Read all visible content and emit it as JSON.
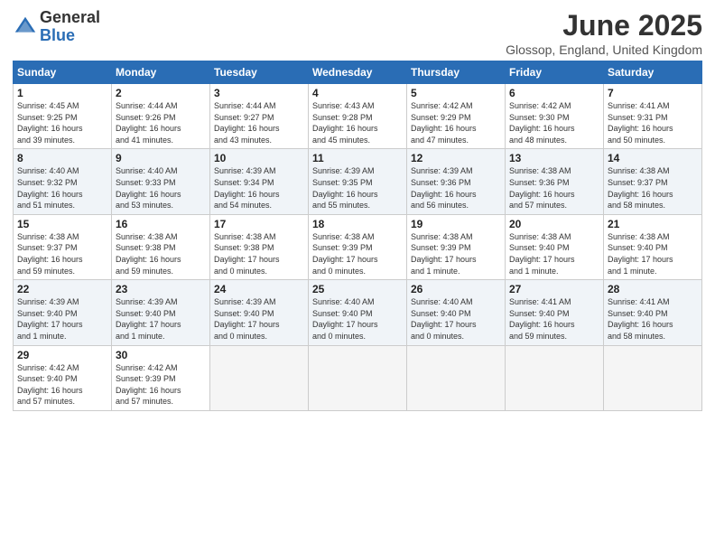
{
  "logo": {
    "general": "General",
    "blue": "Blue"
  },
  "title": "June 2025",
  "subtitle": "Glossop, England, United Kingdom",
  "days_of_week": [
    "Sunday",
    "Monday",
    "Tuesday",
    "Wednesday",
    "Thursday",
    "Friday",
    "Saturday"
  ],
  "weeks": [
    [
      {
        "day": "1",
        "info": "Sunrise: 4:45 AM\nSunset: 9:25 PM\nDaylight: 16 hours\nand 39 minutes."
      },
      {
        "day": "2",
        "info": "Sunrise: 4:44 AM\nSunset: 9:26 PM\nDaylight: 16 hours\nand 41 minutes."
      },
      {
        "day": "3",
        "info": "Sunrise: 4:44 AM\nSunset: 9:27 PM\nDaylight: 16 hours\nand 43 minutes."
      },
      {
        "day": "4",
        "info": "Sunrise: 4:43 AM\nSunset: 9:28 PM\nDaylight: 16 hours\nand 45 minutes."
      },
      {
        "day": "5",
        "info": "Sunrise: 4:42 AM\nSunset: 9:29 PM\nDaylight: 16 hours\nand 47 minutes."
      },
      {
        "day": "6",
        "info": "Sunrise: 4:42 AM\nSunset: 9:30 PM\nDaylight: 16 hours\nand 48 minutes."
      },
      {
        "day": "7",
        "info": "Sunrise: 4:41 AM\nSunset: 9:31 PM\nDaylight: 16 hours\nand 50 minutes."
      }
    ],
    [
      {
        "day": "8",
        "info": "Sunrise: 4:40 AM\nSunset: 9:32 PM\nDaylight: 16 hours\nand 51 minutes."
      },
      {
        "day": "9",
        "info": "Sunrise: 4:40 AM\nSunset: 9:33 PM\nDaylight: 16 hours\nand 53 minutes."
      },
      {
        "day": "10",
        "info": "Sunrise: 4:39 AM\nSunset: 9:34 PM\nDaylight: 16 hours\nand 54 minutes."
      },
      {
        "day": "11",
        "info": "Sunrise: 4:39 AM\nSunset: 9:35 PM\nDaylight: 16 hours\nand 55 minutes."
      },
      {
        "day": "12",
        "info": "Sunrise: 4:39 AM\nSunset: 9:36 PM\nDaylight: 16 hours\nand 56 minutes."
      },
      {
        "day": "13",
        "info": "Sunrise: 4:38 AM\nSunset: 9:36 PM\nDaylight: 16 hours\nand 57 minutes."
      },
      {
        "day": "14",
        "info": "Sunrise: 4:38 AM\nSunset: 9:37 PM\nDaylight: 16 hours\nand 58 minutes."
      }
    ],
    [
      {
        "day": "15",
        "info": "Sunrise: 4:38 AM\nSunset: 9:37 PM\nDaylight: 16 hours\nand 59 minutes."
      },
      {
        "day": "16",
        "info": "Sunrise: 4:38 AM\nSunset: 9:38 PM\nDaylight: 16 hours\nand 59 minutes."
      },
      {
        "day": "17",
        "info": "Sunrise: 4:38 AM\nSunset: 9:38 PM\nDaylight: 17 hours\nand 0 minutes."
      },
      {
        "day": "18",
        "info": "Sunrise: 4:38 AM\nSunset: 9:39 PM\nDaylight: 17 hours\nand 0 minutes."
      },
      {
        "day": "19",
        "info": "Sunrise: 4:38 AM\nSunset: 9:39 PM\nDaylight: 17 hours\nand 1 minute."
      },
      {
        "day": "20",
        "info": "Sunrise: 4:38 AM\nSunset: 9:40 PM\nDaylight: 17 hours\nand 1 minute."
      },
      {
        "day": "21",
        "info": "Sunrise: 4:38 AM\nSunset: 9:40 PM\nDaylight: 17 hours\nand 1 minute."
      }
    ],
    [
      {
        "day": "22",
        "info": "Sunrise: 4:39 AM\nSunset: 9:40 PM\nDaylight: 17 hours\nand 1 minute."
      },
      {
        "day": "23",
        "info": "Sunrise: 4:39 AM\nSunset: 9:40 PM\nDaylight: 17 hours\nand 1 minute."
      },
      {
        "day": "24",
        "info": "Sunrise: 4:39 AM\nSunset: 9:40 PM\nDaylight: 17 hours\nand 0 minutes."
      },
      {
        "day": "25",
        "info": "Sunrise: 4:40 AM\nSunset: 9:40 PM\nDaylight: 17 hours\nand 0 minutes."
      },
      {
        "day": "26",
        "info": "Sunrise: 4:40 AM\nSunset: 9:40 PM\nDaylight: 17 hours\nand 0 minutes."
      },
      {
        "day": "27",
        "info": "Sunrise: 4:41 AM\nSunset: 9:40 PM\nDaylight: 16 hours\nand 59 minutes."
      },
      {
        "day": "28",
        "info": "Sunrise: 4:41 AM\nSunset: 9:40 PM\nDaylight: 16 hours\nand 58 minutes."
      }
    ],
    [
      {
        "day": "29",
        "info": "Sunrise: 4:42 AM\nSunset: 9:40 PM\nDaylight: 16 hours\nand 57 minutes."
      },
      {
        "day": "30",
        "info": "Sunrise: 4:42 AM\nSunset: 9:39 PM\nDaylight: 16 hours\nand 57 minutes."
      },
      {
        "day": "",
        "info": ""
      },
      {
        "day": "",
        "info": ""
      },
      {
        "day": "",
        "info": ""
      },
      {
        "day": "",
        "info": ""
      },
      {
        "day": "",
        "info": ""
      }
    ]
  ]
}
